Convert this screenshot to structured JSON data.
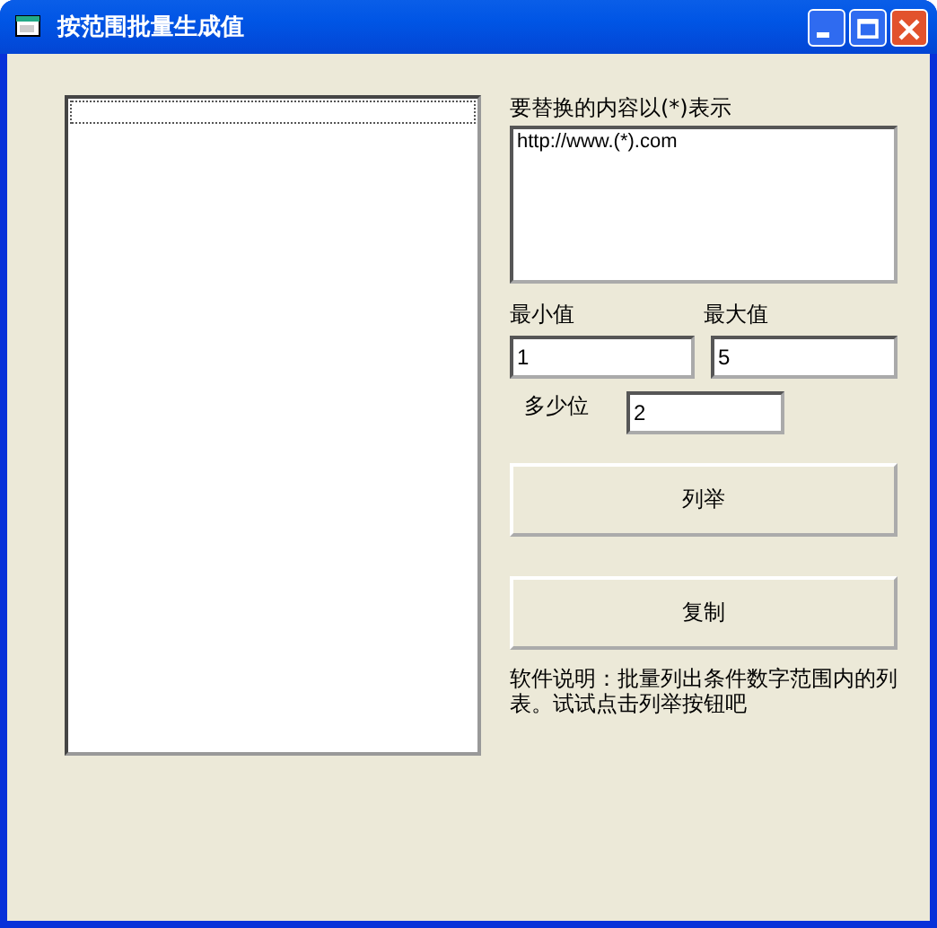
{
  "window": {
    "title": "按范围批量生成值"
  },
  "content_label": "要替换的内容以(*)表示",
  "content_value": "http://www.(*).com",
  "min_label": "最小值",
  "max_label": "最大值",
  "min_value": "1",
  "max_value": "5",
  "digits_label": "多少位",
  "digits_value": "2",
  "buttons": [
    {
      "label": "列举"
    },
    {
      "label": "复制"
    }
  ],
  "description": "软件说明：批量列出条件数字范围内的列表。试试点击列举按钮吧"
}
